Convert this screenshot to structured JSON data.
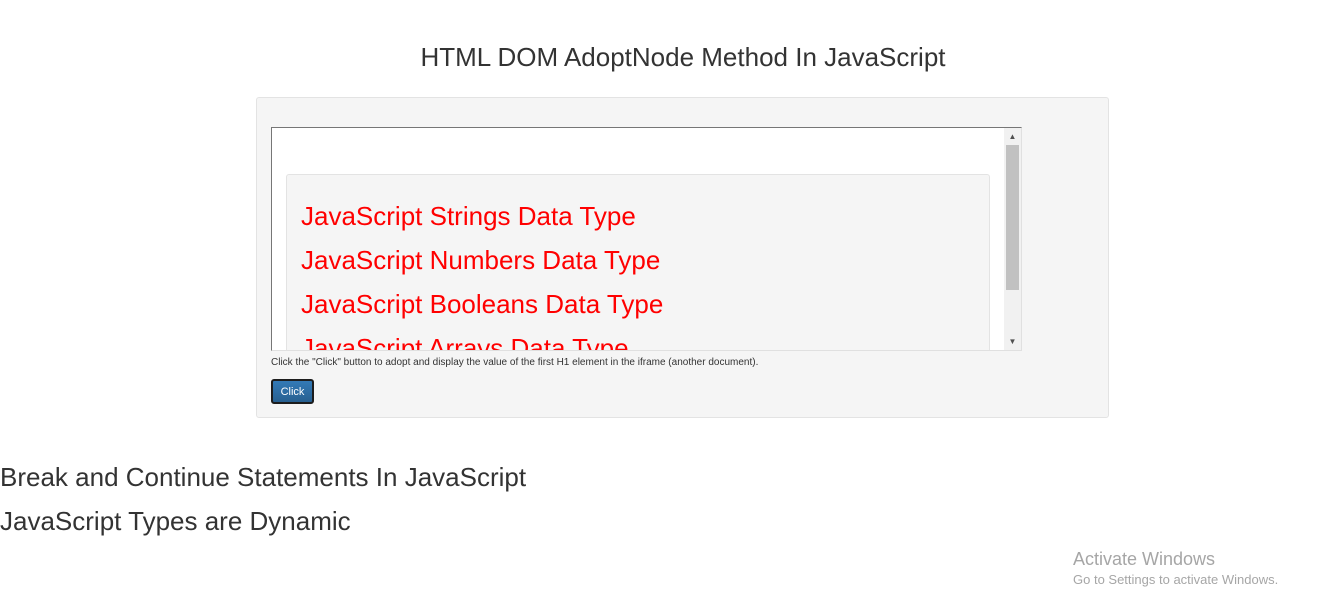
{
  "page": {
    "title": "HTML DOM AdoptNode Method In JavaScript"
  },
  "iframe": {
    "headings": [
      "JavaScript Strings Data Type",
      "JavaScript Numbers Data Type",
      "JavaScript Booleans Data Type",
      "JavaScript Arrays Data Type"
    ],
    "scroll_up_glyph": "▲",
    "scroll_down_glyph": "▼"
  },
  "demo": {
    "instruction": "Click the \"Click\" button to adopt and display the value of the first H1 element in the iframe (another document).",
    "button_label": "Click"
  },
  "results": [
    "Break and Continue Statements In JavaScript",
    "JavaScript Types are Dynamic"
  ],
  "watermark": {
    "title": "Activate Windows",
    "subtitle": "Go to Settings to activate Windows."
  },
  "colors": {
    "heading_red": "#ff0000",
    "button_blue": "#337ab7",
    "panel_bg": "#f5f5f5"
  }
}
